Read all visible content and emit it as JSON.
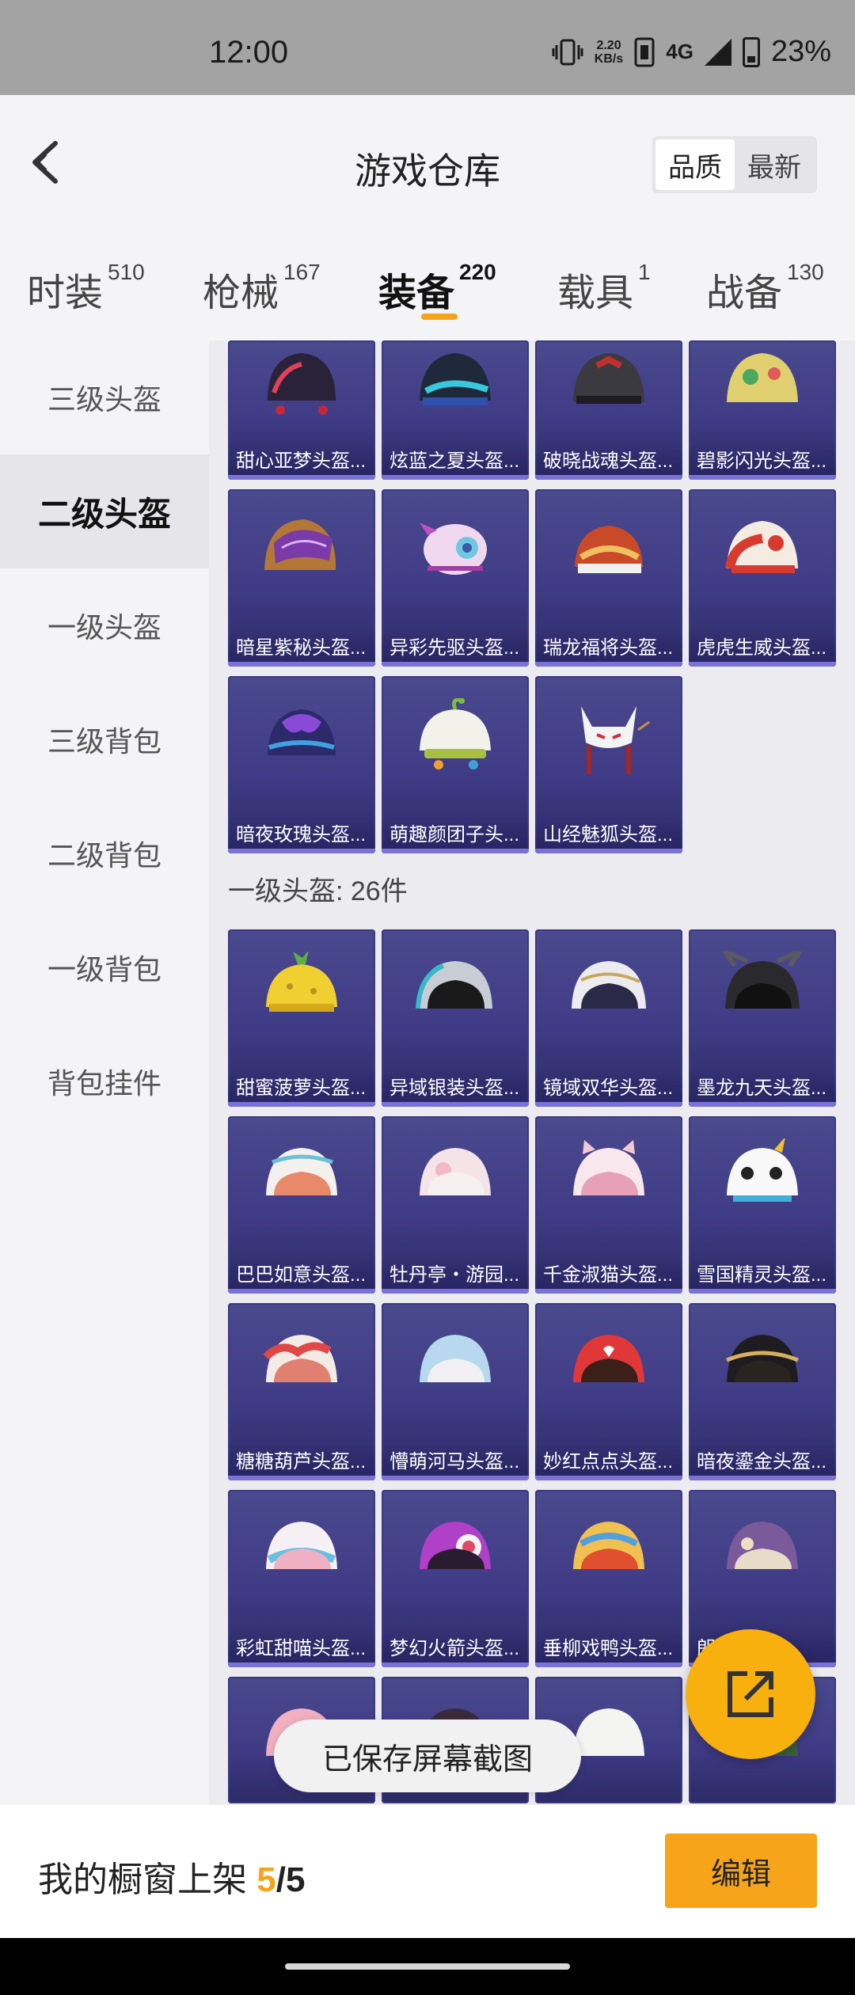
{
  "status_bar": {
    "time": "12:00",
    "net_speed_top": "2.20",
    "net_speed_bottom": "KB/s",
    "network": "4G",
    "battery": "23%"
  },
  "header": {
    "title": "游戏仓库",
    "sort": [
      "品质",
      "最新"
    ]
  },
  "tabs": [
    {
      "label": "时装",
      "count": "510"
    },
    {
      "label": "枪械",
      "count": "167"
    },
    {
      "label": "装备",
      "count": "220"
    },
    {
      "label": "载具",
      "count": "1"
    },
    {
      "label": "战备",
      "count": "130"
    }
  ],
  "sidebar": [
    "三级头盔",
    "二级头盔",
    "一级头盔",
    "三级背包",
    "二级背包",
    "一级背包",
    "背包挂件"
  ],
  "section_level1": {
    "title": "一级头盔: 26件"
  },
  "items_level2": [
    "甜心亚梦头盔...",
    "炫蓝之夏头盔...",
    "破晓战魂头盔...",
    "碧影闪光头盔...",
    "暗星紫秘头盔...",
    "异彩先驱头盔...",
    "瑞龙福将头盔...",
    "虎虎生威头盔...",
    "暗夜玫瑰头盔...",
    "萌趣颜团子头...",
    "山经魅狐头盔..."
  ],
  "items_level1": [
    "甜蜜菠萝头盔...",
    "异域银装头盔...",
    "镜域双华头盔...",
    "墨龙九天头盔...",
    "巴巴如意头盔...",
    "牡丹亭・游园...",
    "千金淑猫头盔...",
    "雪国精灵头盔...",
    "糖糖葫芦头盔...",
    "懵萌河马头盔...",
    "妙红点点头盔...",
    "暗夜鎏金头盔...",
    "彩虹甜喵头盔...",
    "梦幻火箭头盔...",
    "垂柳戏鸭头盔...",
    "朗...头盔..."
  ],
  "toast": "已保存屏幕截图",
  "bottom_bar": {
    "label": "我的橱窗上架",
    "current": "5",
    "total": "/5",
    "edit": "编辑"
  },
  "colors": {
    "accent": "#f6a51a",
    "card_bg": "#403b86"
  },
  "icons": {
    "back": "chevron-left-icon",
    "share": "share-external-icon"
  }
}
